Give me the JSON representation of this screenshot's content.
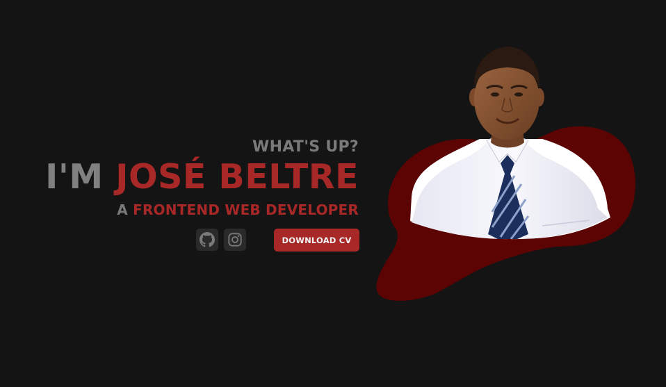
{
  "hero": {
    "greeting": "WHAT'S UP?",
    "name_prefix": "I'M ",
    "name_highlight": "JOSÉ BELTRE",
    "role_prefix": "A ",
    "role_highlight": "FRONTEND WEB DEVELOPER"
  },
  "social": {
    "icons": [
      "github-icon",
      "instagram-icon"
    ]
  },
  "actions": {
    "download_cv_label": "DOWNLOAD CV"
  },
  "colors": {
    "background": "#141414",
    "accent": "#a82828",
    "muted_text": "#7a7a7a",
    "blob": "#5c0303",
    "button_bg": "#2a2a2a"
  }
}
